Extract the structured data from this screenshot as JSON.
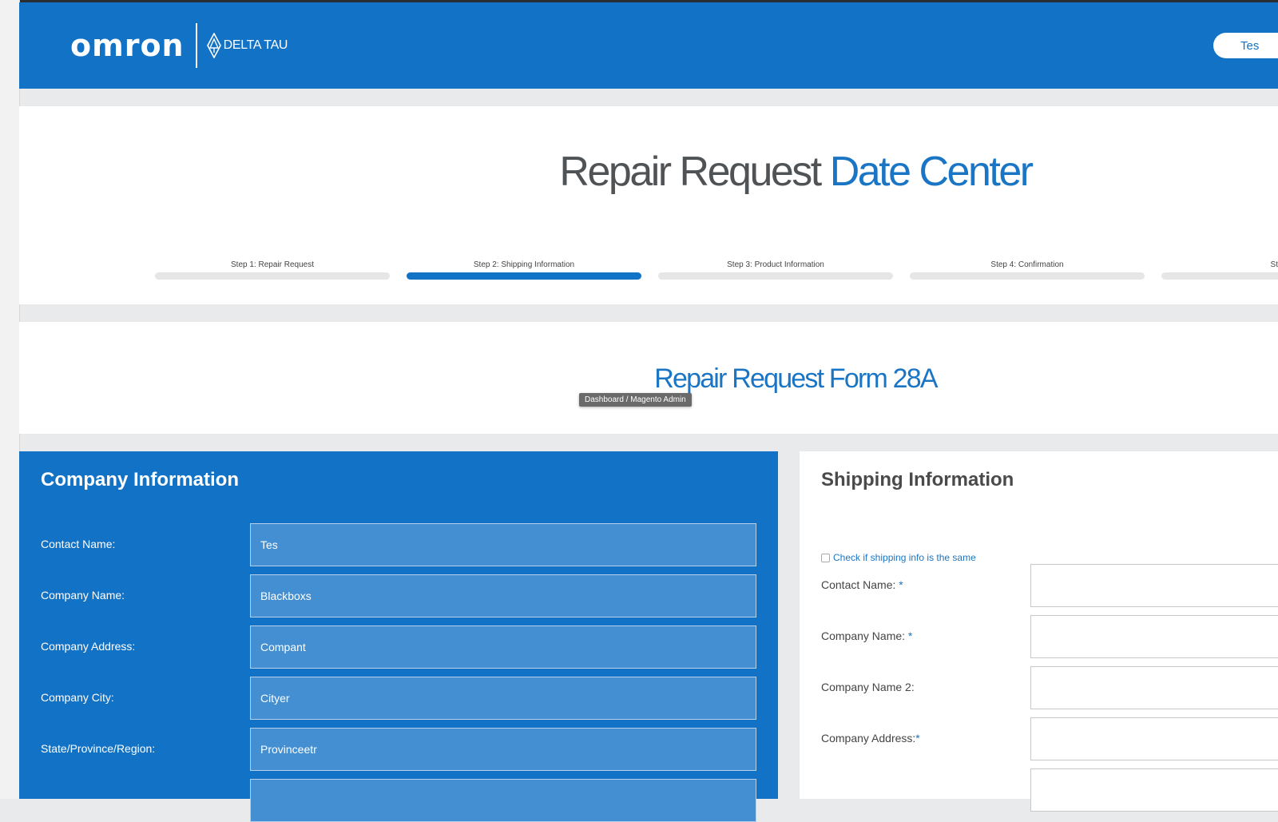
{
  "header": {
    "brand": "omron",
    "sub_brand": "DELTA TAU",
    "user_label": "Tes",
    "user_chevron": "›"
  },
  "title": {
    "main": "Repair Request",
    "accent": "Date Center"
  },
  "steps": [
    {
      "label": "Step 1: Repair Request",
      "active": false
    },
    {
      "label": "Step 2: Shipping Information",
      "active": true
    },
    {
      "label": "Step 3: Product Information",
      "active": false
    },
    {
      "label": "Step 4: Confirmation",
      "active": false
    },
    {
      "label": "St",
      "active": false
    }
  ],
  "form_title": "Repair Request Form 28A",
  "tooltip": "Dashboard / Magento Admin",
  "company": {
    "heading": "Company Information",
    "fields": [
      {
        "label": "Contact Name:",
        "value": "Tes"
      },
      {
        "label": "Company Name:",
        "value": "Blackboxs"
      },
      {
        "label": "Company Address:",
        "value": "Compant"
      },
      {
        "label": "Company City:",
        "value": "Cityer"
      },
      {
        "label": "State/Province/Region:",
        "value": "Provinceetr"
      },
      {
        "label": "",
        "value": ""
      }
    ]
  },
  "shipping": {
    "heading": "Shipping Information",
    "same_checkbox_label": "Check if shipping info is the same",
    "same_checked": false,
    "fields": [
      {
        "label": "Contact Name:",
        "required_mark": " *",
        "value": ""
      },
      {
        "label": "Company Name:",
        "required_mark": " *",
        "value": ""
      },
      {
        "label": "Company Name 2:",
        "required_mark": "",
        "value": ""
      },
      {
        "label": "Company Address:",
        "required_mark": "*",
        "value": ""
      },
      {
        "label": "",
        "required_mark": "",
        "value": ""
      }
    ]
  },
  "colors": {
    "brand_blue": "#1272c6",
    "accent_blue": "#1a76c4",
    "field_blue": "#438fd2"
  }
}
